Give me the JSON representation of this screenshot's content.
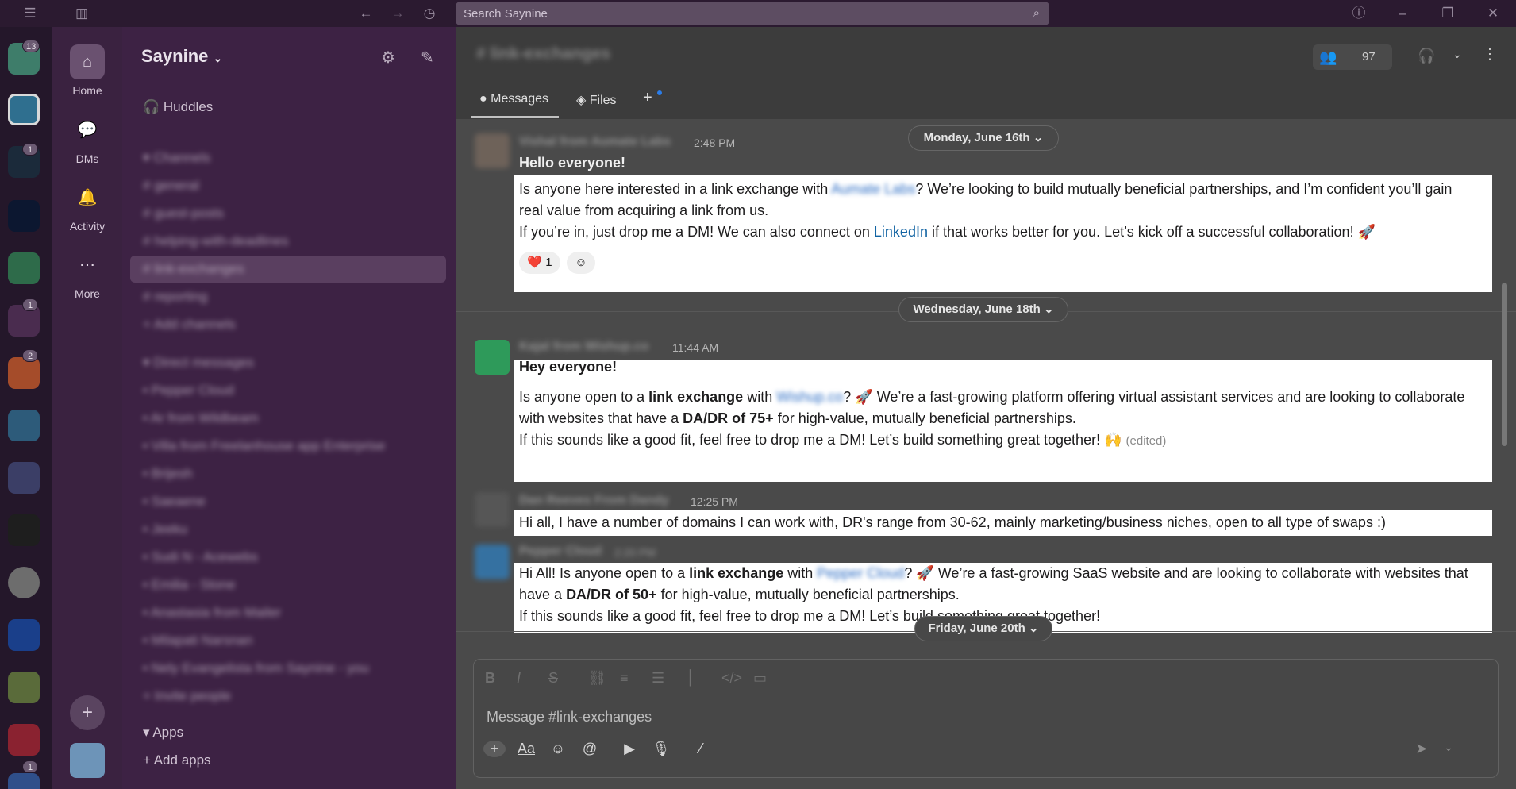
{
  "app": {
    "search_placeholder": "Search Saynine",
    "workspace_name": "Saynine"
  },
  "rail": {
    "badges": [
      "13",
      "1",
      "1",
      "2",
      "1"
    ]
  },
  "nav": {
    "home": "Home",
    "dms": "DMs",
    "activity": "Activity",
    "more": "More"
  },
  "sidebar": {
    "huddles": "Huddles",
    "channels_header": "Channels",
    "channels": [
      "general",
      "guest-posts",
      "helping-with-deadlines",
      "link-exchanges",
      "reporting",
      "Add channels"
    ],
    "dm_header": "Direct messages",
    "dms": [
      "Pepper Cloud",
      "Ar from Wildbeam",
      "Villa from Freelanhouse app Enterprise",
      "Brijesh",
      "Saeaene",
      "Jeeku",
      "Sudi N - Acewebs",
      "Emilia - Stone",
      "Anastasia from Mailer",
      "Milapati Narsnan",
      "Nely Evangelista from Saynine - you",
      "Invite people"
    ],
    "apps_header": "Apps",
    "add_apps": "Add apps"
  },
  "channel": {
    "title": "# link-exchanges",
    "tabs": [
      "Messages",
      "Files"
    ],
    "member_count": "97"
  },
  "dates": [
    "Monday, June 16th",
    "Wednesday, June 18th",
    "Friday, June 20th"
  ],
  "messages": [
    {
      "author": "Vishal from Aumate Labs",
      "time": "2:48 PM",
      "heading": "Hello everyone!",
      "line1a": "Is anyone here interested in a link exchange with",
      "line1link": "Aumate Labs",
      "line1b": "? We’re looking to build mutually beneficial partnerships, and I’m confident you’ll gain",
      "line2": "real value from acquiring a link from us.",
      "line3a": "If you’re in, just drop me a DM! We can also connect on",
      "line3link": "LinkedIn",
      "line3b": "if that works better for you. Let’s kick off a successful collaboration! 🚀",
      "reaction": "❤️ 1"
    },
    {
      "author": "Kajal from Wishup.co",
      "time": "11:44 AM",
      "heading": "Hey everyone!",
      "l1a": "Is anyone open to a",
      "l1b": "link exchange",
      "l1c": "with",
      "l1link": "Wishup.co",
      "l1d": "? 🚀 We’re a fast-growing platform offering virtual assistant services and are looking to collaborate",
      "l2a": "with websites that have a",
      "l2b": "DA/DR of 75+",
      "l2c": "for high-value, mutually beneficial partnerships.",
      "l3": "If this sounds like a good fit, feel free to drop me a DM! Let’s build something great together! 🙌",
      "edited": "(edited)"
    },
    {
      "author": "Dan Reeves From Dandy",
      "time": "12:25 PM",
      "text": "Hi all, I have a number of domains I can work with, DR's range from 30-62, mainly marketing/business niches, open to all type of swaps :)"
    },
    {
      "author": "Pepper Cloud",
      "time": "2:20 PM",
      "l1a": "Hi All! Is anyone open to a",
      "l1b": "link exchange",
      "l1c": "with",
      "l1link": "Pepper Cloud",
      "l1d": "? 🚀 We’re a fast-growing SaaS website and are looking to collaborate with websites that",
      "l2a": "have a",
      "l2b": "DA/DR of 50+",
      "l2c": "for high-value, mutually beneficial partnerships.",
      "l3": "If this sounds like a good fit, feel free to drop me a DM! Let’s build something great together!"
    }
  ],
  "composer": {
    "placeholder": "Message #link-exchanges"
  },
  "colors": {
    "rail_bg": "#24172a",
    "sidebar_bg": "#3d2244",
    "main_bg": "#4a4a4a",
    "link": "#1264a3"
  }
}
